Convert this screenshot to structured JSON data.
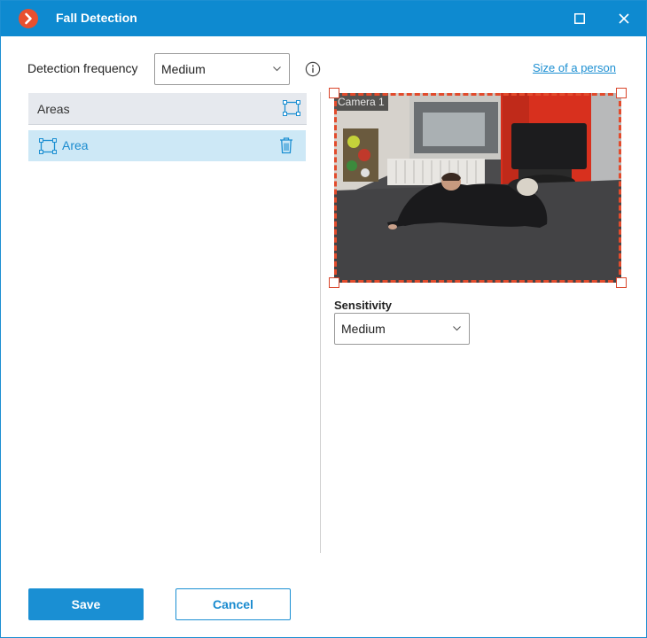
{
  "window": {
    "title": "Fall Detection",
    "accent_color": "#0e8ad0",
    "logo_icon": "app-logo-chevron",
    "controls": [
      "maximize-icon",
      "close-icon"
    ]
  },
  "detection_frequency": {
    "label": "Detection frequency",
    "value": "Medium",
    "info_icon": "info-icon"
  },
  "size_link": "Size of a person",
  "areas": {
    "header": "Areas",
    "items": [
      {
        "label": "Area",
        "selected": true
      }
    ]
  },
  "camera": {
    "label": "Camera 1",
    "zone_color": "#e24b2c"
  },
  "sensitivity": {
    "label": "Sensitivity",
    "value": "Medium"
  },
  "buttons": {
    "save": "Save",
    "cancel": "Cancel"
  }
}
